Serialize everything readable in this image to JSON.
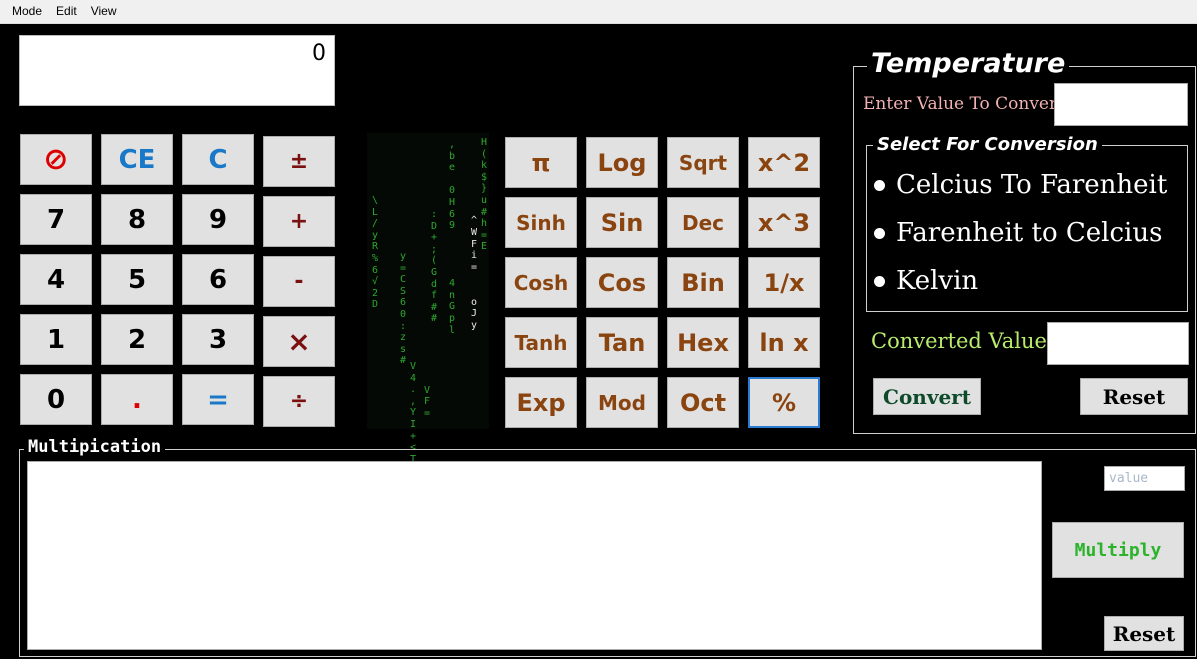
{
  "menu": [
    "Mode",
    "Edit",
    "View"
  ],
  "display": {
    "value": "0"
  },
  "keypad": {
    "clear_icon": "⊘",
    "ce": "CE",
    "c": "C",
    "plusminus": "±",
    "n7": "7",
    "n8": "8",
    "n9": "9",
    "plus": "+",
    "n4": "4",
    "n5": "5",
    "n6": "6",
    "minus": "-",
    "n1": "1",
    "n2": "2",
    "n3": "3",
    "times": "×",
    "n0": "0",
    "dot": ".",
    "equals": "=",
    "divide": "÷"
  },
  "scientific": {
    "pi": "π",
    "log": "Log",
    "sqrt": "Sqrt",
    "x2": "x^2",
    "sinh": "Sinh",
    "sin": "Sin",
    "dec": "Dec",
    "x3": "x^3",
    "cosh": "Cosh",
    "cos": "Cos",
    "bin": "Bin",
    "inv": "1/x",
    "tanh": "Tanh",
    "tan": "Tan",
    "hex": "Hex",
    "ln": "ln x",
    "exp": "Exp",
    "mod": "Mod",
    "oct": "Oct",
    "percent": "%"
  },
  "matrix_columns": [
    "\\\nL\n/\ny\nR\n%\n6\n√\n2\nD",
    "y\n=\nC\nS\n6\n0\n:\nz\ns\n#",
    "V\n4\n.\n,\nY\nI\n+\n<\nT",
    "\nV\nF\n=",
    ":\nD\n+\n;\n(\nG\nd\nf\n#\n#",
    ",\nb\ne\n\n0\nH\n6\n9\n\n\n\n\n4\nn\nG\np\nl",
    "\n\n\n\n^\nW\nF\ni\n=\n\n\no\nJ\ny",
    "H\n(\nk\n$\n}\nu\n#\nh\n=\nE"
  ],
  "temperature": {
    "title": "Temperature",
    "enter_label": "Enter Value To Convert",
    "input_value": "",
    "select_title": "Select For Conversion",
    "options": [
      "Celcius To Farenheit",
      "Farenheit to Celcius",
      "Kelvin"
    ],
    "converted_label": "Converted Value",
    "converted_value": "",
    "convert_button": "Convert",
    "reset_button": "Reset"
  },
  "multiplication": {
    "title": "Multipication",
    "output_text": "",
    "value_placeholder": "value",
    "multiply_button": "Multiply",
    "reset_button": "Reset"
  },
  "colors": {
    "background": "#000000",
    "button_face": "#e1e1e1",
    "operator": "#7b1010",
    "blue": "#1a78c8",
    "scientific": "#8a4410",
    "enter_label": "#f2b2b2",
    "converted_label": "#b8ec6c",
    "convert_text": "#0d4a2a",
    "multiply_text": "#2bb32b",
    "matrix": "#2fa82f"
  }
}
